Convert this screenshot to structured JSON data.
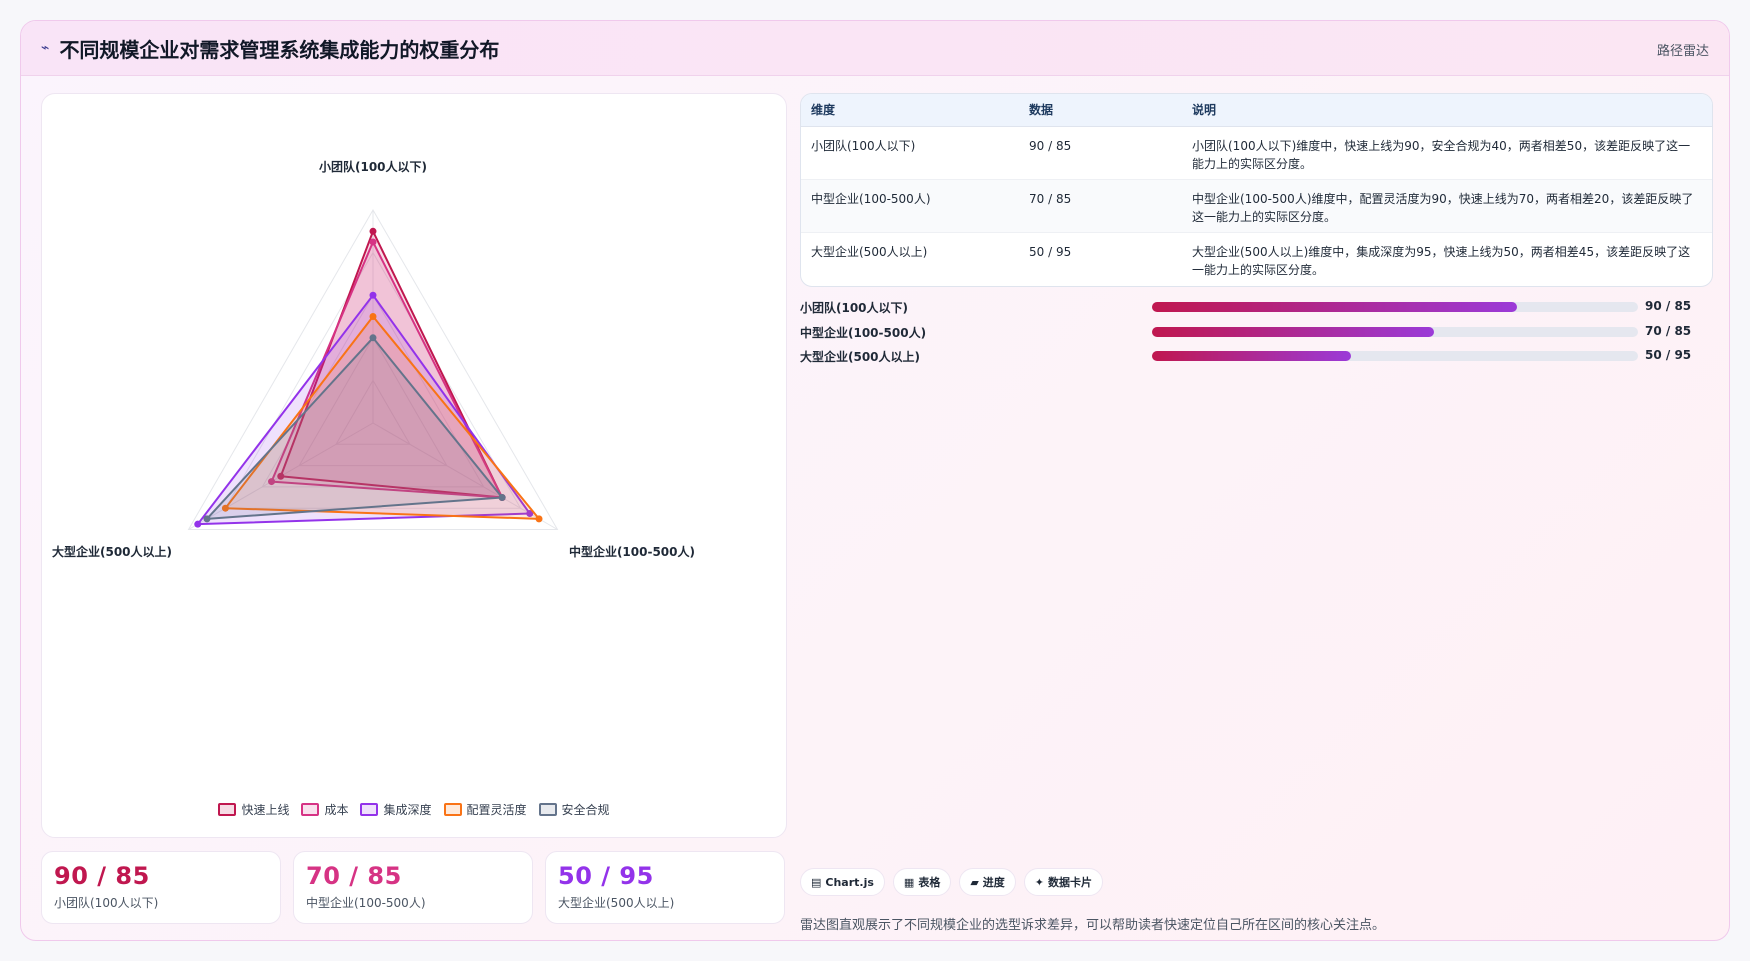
{
  "header": {
    "logo": "⌁",
    "title": "不同规模企业对需求管理系统集成能力的权重分布",
    "tag": "路径雷达"
  },
  "chart_data": {
    "type": "radar",
    "title": "",
    "axes": [
      "小团队(100人以下)",
      "中型企业(100-500人)",
      "大型企业(500人以上)"
    ],
    "range": [
      0,
      100
    ],
    "grid": true,
    "legend_position": "bottom",
    "series": [
      {
        "name": "快速上线",
        "values": [
          90,
          70,
          50
        ],
        "color": "#c0174f"
      },
      {
        "name": "成本",
        "values": [
          85,
          70,
          55
        ],
        "color": "#d63384"
      },
      {
        "name": "集成深度",
        "values": [
          60,
          85,
          95
        ],
        "color": "#9333ea"
      },
      {
        "name": "配置灵活度",
        "values": [
          50,
          90,
          80
        ],
        "color": "#f97316"
      },
      {
        "name": "安全合规",
        "values": [
          40,
          70,
          90
        ],
        "color": "#64748b"
      }
    ]
  },
  "table": {
    "headers": [
      "维度",
      "数据",
      "说明"
    ],
    "rows": [
      {
        "dim": "小团队(100人以下)",
        "data": "90 / 85",
        "desc": "小团队(100人以下)维度中，快速上线为90，安全合规为40，两者相差50，该差距反映了这一能力上的实际区分度。"
      },
      {
        "dim": "中型企业(100-500人)",
        "data": "70 / 85",
        "desc": "中型企业(100-500人)维度中，配置灵活度为90，快速上线为70，两者相差20，该差距反映了这一能力上的实际区分度。"
      },
      {
        "dim": "大型企业(500人以上)",
        "data": "50 / 95",
        "desc": "大型企业(500人以上)维度中，集成深度为95，快速上线为50，两者相差45，该差距反映了这一能力上的实际区分度。"
      }
    ]
  },
  "progress": [
    {
      "label": "小团队(100人以下)",
      "value": "90 / 85",
      "fraction": 0.75
    },
    {
      "label": "中型企业(100-500人)",
      "value": "70 / 85",
      "fraction": 0.58
    },
    {
      "label": "大型企业(500人以上)",
      "value": "50 / 95",
      "fraction": 0.41
    }
  ],
  "kpis": [
    {
      "value": "90 / 85",
      "label": "小团队(100人以下)",
      "color": "#c0174f"
    },
    {
      "value": "70 / 85",
      "label": "中型企业(100-500人)",
      "color": "#d63384"
    },
    {
      "value": "50 / 95",
      "label": "大型企业(500人以上)",
      "color": "#9333ea"
    }
  ],
  "chips": [
    {
      "icon": "▤",
      "label": "Chart.js"
    },
    {
      "icon": "▦",
      "label": "表格"
    },
    {
      "icon": "▰",
      "label": "进度"
    },
    {
      "icon": "✦",
      "label": "数据卡片"
    }
  ],
  "footnote": "雷达图直观展示了不同规模企业的选型诉求差异，可以帮助读者快速定位自己所在区间的核心关注点。"
}
